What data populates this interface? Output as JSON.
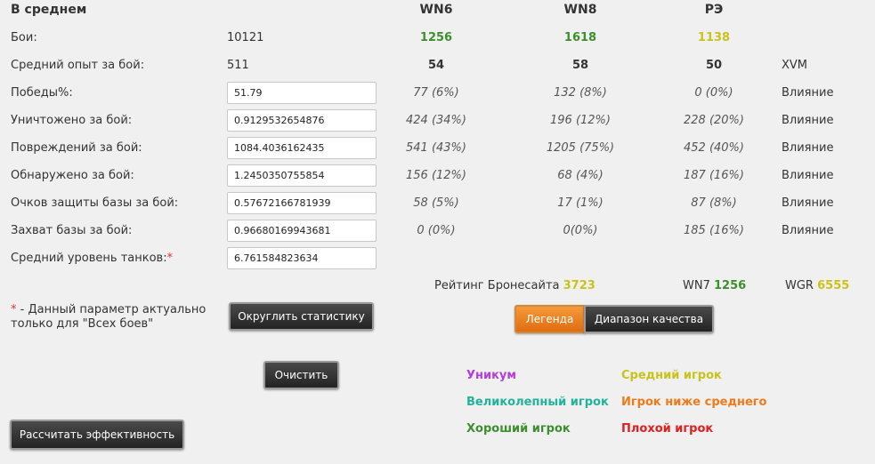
{
  "header": {
    "avg": "В среднем",
    "wn6": "WN6",
    "wn8": "WN8",
    "re": "РЭ"
  },
  "battles": {
    "label": "Бои:",
    "value": "10121",
    "wn6": "1256",
    "wn8": "1618",
    "re": "1138"
  },
  "avg_xp": {
    "label": "Средний опыт за бой:",
    "value": "511",
    "wn6": "54",
    "wn8": "58",
    "re": "50",
    "extra": "XVM"
  },
  "rows": [
    {
      "label": "Победы%:",
      "value": "51.79",
      "wn6": "77 (6%)",
      "wn8": "132 (8%)",
      "re": "0 (0%)",
      "extra": "Влияние"
    },
    {
      "label": "Уничтожено за бой:",
      "value": "0.9129532654876",
      "wn6": "424 (34%)",
      "wn8": "196 (12%)",
      "re": "228 (20%)",
      "extra": "Влияние"
    },
    {
      "label": "Повреждений за бой:",
      "value": "1084.4036162435",
      "wn6": "541 (43%)",
      "wn8": "1205 (75%)",
      "re": "452 (40%)",
      "extra": "Влияние"
    },
    {
      "label": "Обнаружено за бой:",
      "value": "1.2450350755854",
      "wn6": "156 (12%)",
      "wn8": "68 (4%)",
      "re": "187 (16%)",
      "extra": "Влияние"
    },
    {
      "label": "Очков защиты базы за бой:",
      "value": "0.57672166781939",
      "wn6": "58 (5%)",
      "wn8": "17 (1%)",
      "re": "87 (8%)",
      "extra": "Влияние"
    },
    {
      "label": "Захват базы за бой:",
      "value": "0.96680169943681",
      "wn6": "0 (0%)",
      "wn8": "0(0%)",
      "re": "185 (16%)",
      "extra": "Влияние"
    }
  ],
  "tank_level": {
    "label": "Средний уровень танков:",
    "star": "*",
    "value": "6.761584823634"
  },
  "ratings": {
    "armor_label": "Рейтинг Бронесайта",
    "armor_value": "3723",
    "wn7_label": "WN7",
    "wn7_value": "1256",
    "wgr_label": "WGR",
    "wgr_value": "6555"
  },
  "note": {
    "star": "*",
    "line1": " - Данный параметр актуально",
    "line2": "только для \"Всех боев\""
  },
  "buttons": {
    "round": "Округлить статистику",
    "legend": "Легенда",
    "quality": "Диапазон качества",
    "clear": "Очистить",
    "calc": "Рассчитать эффективность"
  },
  "legend": {
    "unicum": "Уникум",
    "great": "Великолепный игрок",
    "good": "Хороший игрок",
    "average": "Средний игрок",
    "below": "Игрок ниже среднего",
    "bad": "Плохой игрок"
  },
  "colors": {
    "unicum": "#b23fd6",
    "great": "#21b39a",
    "good": "#3d8f2e",
    "average": "#c9c21b",
    "below": "#f07a1a",
    "bad": "#e02020"
  }
}
